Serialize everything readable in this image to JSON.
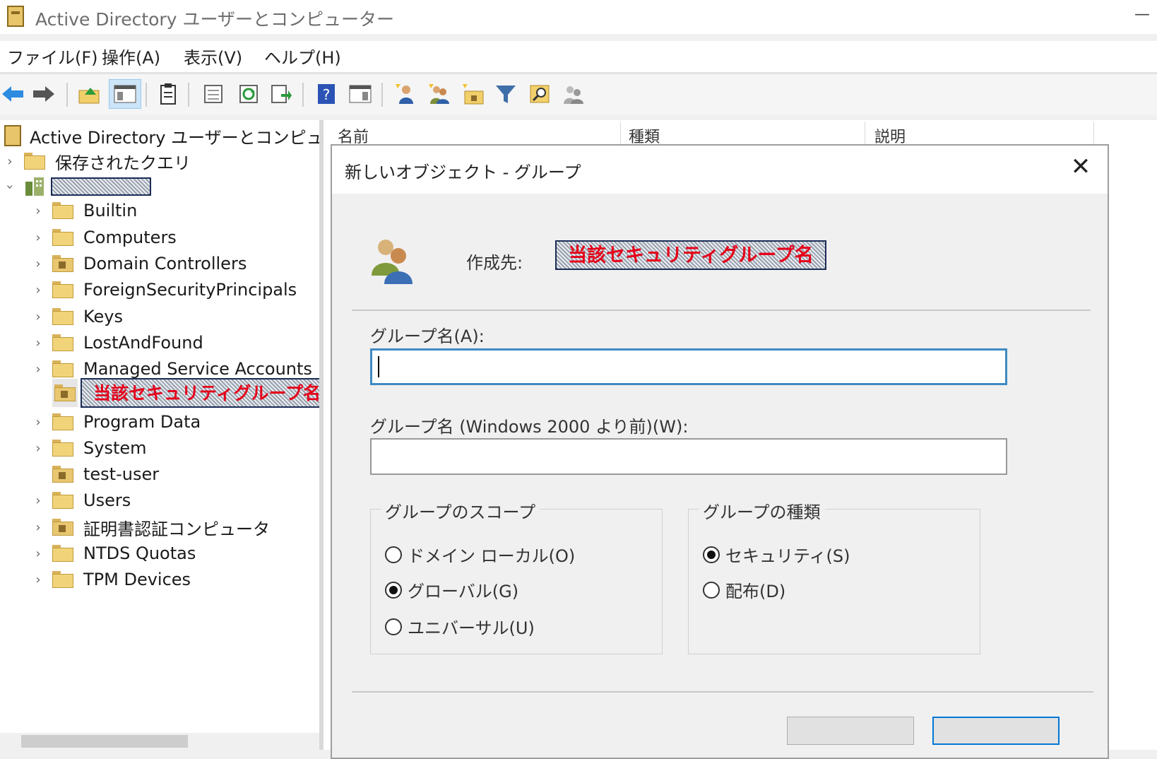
{
  "window": {
    "title": "Active Directory ユーザーとコンピューター",
    "minimize": "—"
  },
  "menu": [
    "ファイル(F)",
    "操作(A)",
    "表示(V)",
    "ヘルプ(H)"
  ],
  "toolbar": {
    "icons": [
      "back-arrow-icon",
      "forward-arrow-icon",
      "up-folder-icon",
      "console-tree-icon",
      "clipboard-icon",
      "properties-icon",
      "refresh-icon",
      "export-list-icon",
      "help-icon",
      "show-action-pane-icon",
      "new-user-icon",
      "new-group-icon",
      "new-ou-icon",
      "filter-icon",
      "find-icon",
      "delegate-icon"
    ]
  },
  "tree": {
    "root": "Active Directory ユーザーとコンピューター",
    "saved_queries": "保存されたクエリ",
    "items": [
      "Builtin",
      "Computers",
      "Domain Controllers",
      "ForeignSecurityPrincipals",
      "Keys",
      "LostAndFound",
      "Managed Service Accounts",
      "当該セキュリティグループ名",
      "Program Data",
      "System",
      "test-user",
      "Users",
      "証明書認証コンピュータ",
      "NTDS Quotas",
      "TPM Devices"
    ]
  },
  "list": {
    "columns": [
      "名前",
      "種類",
      "説明"
    ]
  },
  "dialog": {
    "title": "新しいオブジェクト - グループ",
    "close": "✕",
    "create_in_label": "作成先:",
    "create_in_value": "当該セキュリティグループ名",
    "group_name_label": "グループ名(A):",
    "group_name_value": "",
    "pre2000_label": "グループ名 (Windows 2000 より前)(W):",
    "pre2000_value": "",
    "scope": {
      "title": "グループのスコープ",
      "options": [
        "ドメイン ローカル(O)",
        "グローバル(G)",
        "ユニバーサル(U)"
      ],
      "selected": "グローバル(G)"
    },
    "type": {
      "title": "グループの種類",
      "options": [
        "セキュリティ(S)",
        "配布(D)"
      ],
      "selected": "セキュリティ(S)"
    }
  },
  "colors": {
    "accent": "#0078d7",
    "redaction_text": "#e50019",
    "focus_border": "#3f8ac4"
  }
}
